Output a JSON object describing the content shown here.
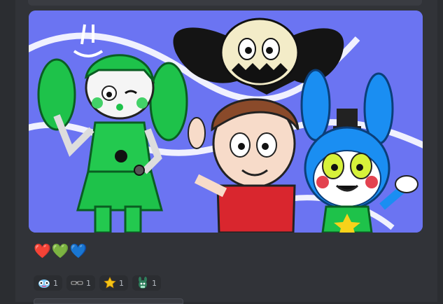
{
  "message": {
    "text": "❤️💚💙"
  },
  "attachment": {
    "icon": "fan-art-image"
  },
  "reactions": [
    {
      "icon": "blue-critter-emoji",
      "count": "1"
    },
    {
      "icon": "sunglasses-emoji",
      "count": "1"
    },
    {
      "icon": "star-emoji",
      "count": "1"
    },
    {
      "icon": "green-bunny-emoji",
      "count": "1"
    }
  ],
  "colors": {
    "background": "#313338",
    "art_background": "#6b74f2",
    "reaction_bg": "#2b2d31",
    "reaction_text": "#b5bac1"
  }
}
